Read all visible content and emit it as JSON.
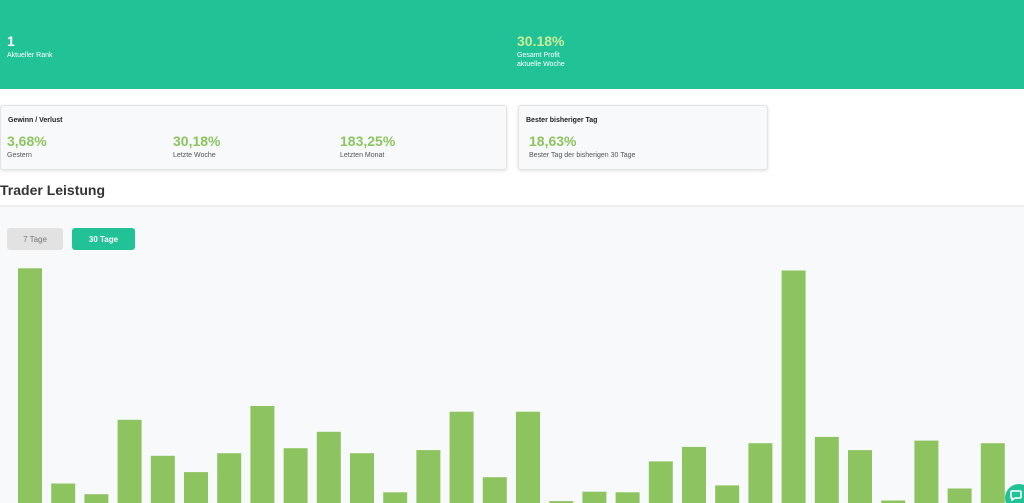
{
  "hero": {
    "rank": {
      "value": "1",
      "label": "Aktueller Rank"
    },
    "profit": {
      "value": "30.18%",
      "label_line1": "Gesamt Profit",
      "label_line2": "aktuelle Woche"
    }
  },
  "gewinn_verlust": {
    "title": "Gewinn / Verlust",
    "metrics": [
      {
        "value": "3,68%",
        "label": "Gestern"
      },
      {
        "value": "30,18%",
        "label": "Letzte Woche"
      },
      {
        "value": "183,25%",
        "label": "Letzten Monat"
      }
    ]
  },
  "best_day": {
    "title": "Bester bisheriger Tag",
    "value": "18,63%",
    "label": "Bester Tag der bisherigen 30 Tage"
  },
  "performance": {
    "title": "Trader Leistung",
    "toggles": {
      "days7": "7 Tage",
      "days30": "30 Tage",
      "active": "30 Tage"
    }
  },
  "colors": {
    "brand": "#22c297",
    "positive": "#8dc45f",
    "hero_highlight": "#c8ee9a"
  },
  "icons": {
    "chat": "chat-bubble-icon"
  },
  "chart_data": {
    "type": "bar",
    "values": [
      18.63,
      1.55,
      0.7,
      6.6,
      3.75,
      2.45,
      3.95,
      7.7,
      4.35,
      5.65,
      3.95,
      0.85,
      4.2,
      7.25,
      2.05,
      7.25,
      0.15,
      0.9,
      0.85,
      3.3,
      4.45,
      1.4,
      4.75,
      18.45,
      5.25,
      4.2,
      0.2,
      4.95,
      1.15,
      4.75
    ],
    "color": "#8dc45f",
    "grid": false
  }
}
